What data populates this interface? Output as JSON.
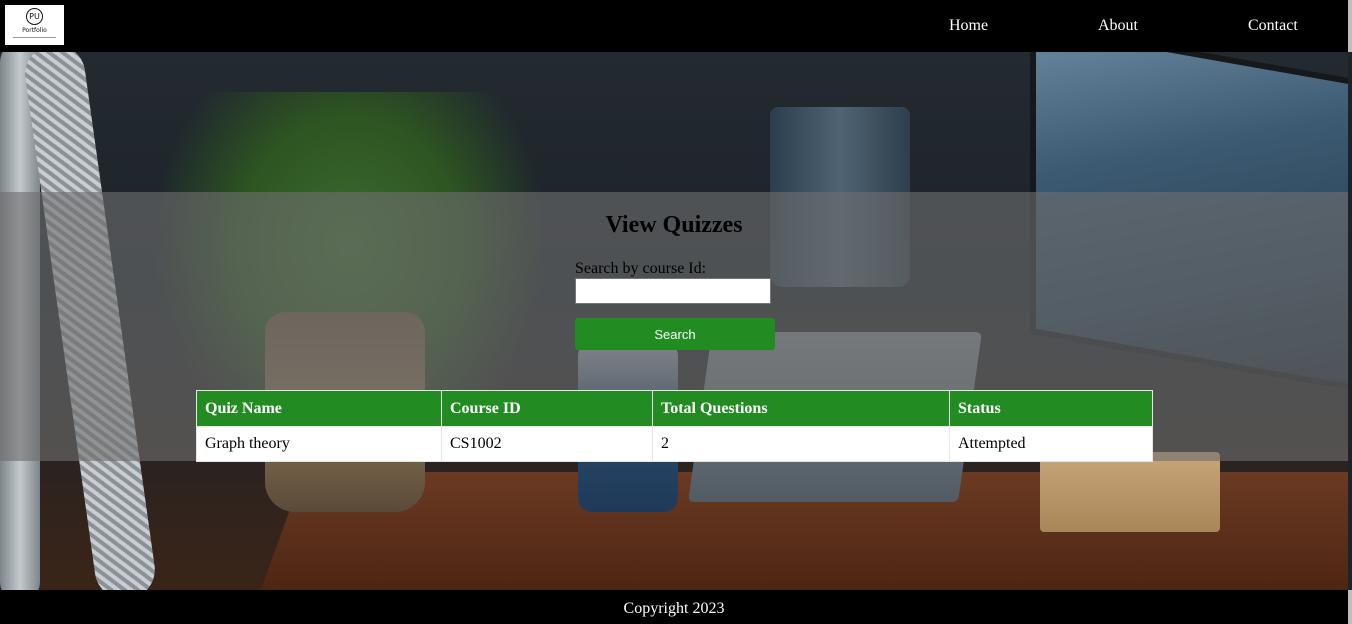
{
  "navbar": {
    "logo_text": "Portfolio",
    "logo_mark": "PU",
    "links": [
      "Home",
      "About",
      "Contact"
    ]
  },
  "main": {
    "title": "View Quizzes",
    "search_label": "Search by course Id:",
    "search_value": "",
    "search_button": "Search"
  },
  "table": {
    "headers": [
      "Quiz Name",
      "Course ID",
      "Total Questions",
      "Status"
    ],
    "rows": [
      [
        "Graph theory",
        "CS1002",
        "2",
        "Attempted"
      ]
    ]
  },
  "footer": {
    "copyright": "Copyright 2023"
  },
  "colors": {
    "accent": "#228b22",
    "navbar": "#000000"
  }
}
